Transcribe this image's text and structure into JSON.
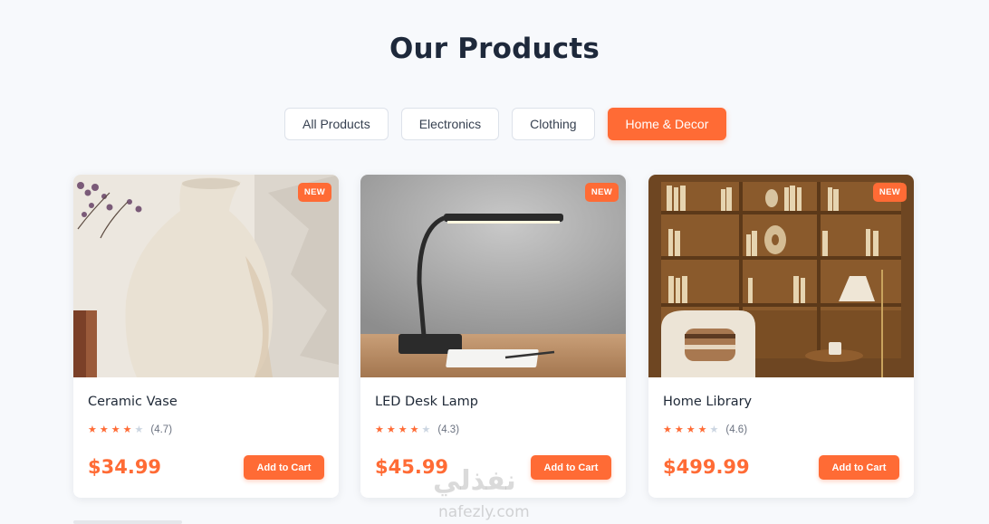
{
  "header": {
    "title": "Our Products"
  },
  "filters": [
    {
      "label": "All Products",
      "active": false
    },
    {
      "label": "Electronics",
      "active": false
    },
    {
      "label": "Clothing",
      "active": false
    },
    {
      "label": "Home & Decor",
      "active": true
    }
  ],
  "products": [
    {
      "name": "Ceramic Vase",
      "badge": "NEW",
      "rating": 4.7,
      "rating_text": "(4.7)",
      "price": "$34.99",
      "cart_label": "Add to Cart",
      "image": "ceramic-vase-image"
    },
    {
      "name": "LED Desk Lamp",
      "badge": "NEW",
      "rating": 4.3,
      "rating_text": "(4.3)",
      "price": "$45.99",
      "cart_label": "Add to Cart",
      "image": "desk-lamp-image"
    },
    {
      "name": "Home Library",
      "badge": "NEW",
      "rating": 4.6,
      "rating_text": "(4.6)",
      "price": "$499.99",
      "cart_label": "Add to Cart",
      "image": "bookshelf-library-image"
    }
  ],
  "watermark": {
    "arabic": "نفذلي",
    "latin": "nafezly.com"
  },
  "colors": {
    "accent": "#ff6b35",
    "background": "#f7f9fc",
    "title": "#1e293b"
  }
}
